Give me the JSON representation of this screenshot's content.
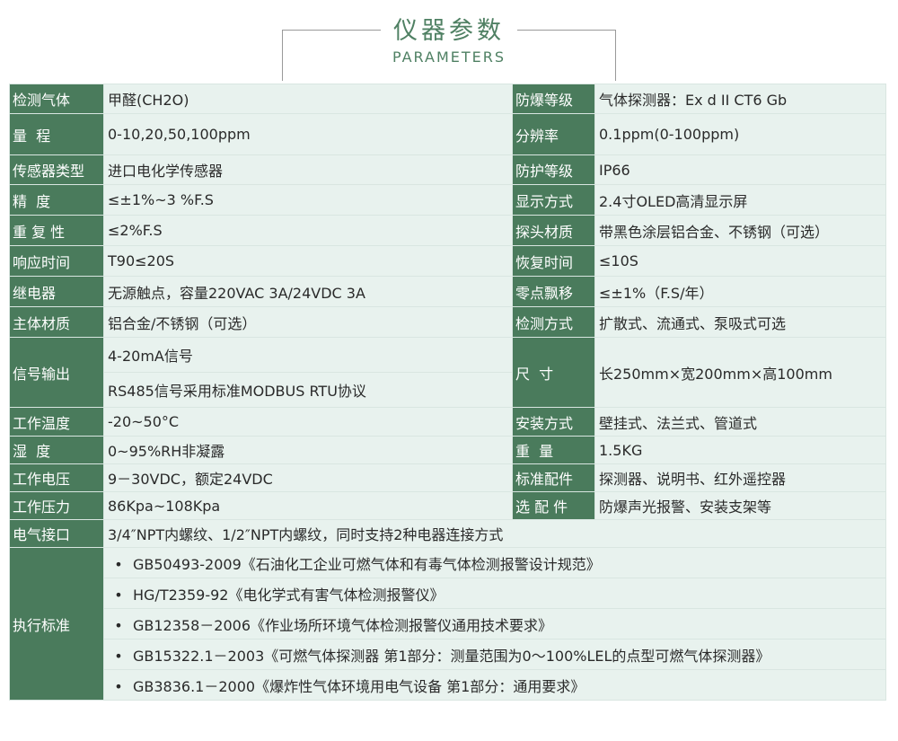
{
  "header": {
    "title": "仪器参数",
    "subtitle": "PARAMETERS"
  },
  "rows": {
    "r1": {
      "l1": "检测气体",
      "v1": "甲醛(CH2O)",
      "l2": "防爆等级",
      "v2": "气体探测器：Ex d II CT6 Gb"
    },
    "r2": {
      "l1": "量  程",
      "v1": "0-10,20,50,100ppm",
      "l2": "分辨率",
      "v2": "0.1ppm(0-100ppm)"
    },
    "r3": {
      "l1": "传感器类型",
      "v1": "进口电化学传感器",
      "l2": "防护等级",
      "v2": "IP66"
    },
    "r4": {
      "l1": "精  度",
      "v1": "≤±1%~3 %F.S",
      "l2": "显示方式",
      "v2": "2.4寸OLED高清显示屏"
    },
    "r5": {
      "l1": "重 复 性",
      "v1": "≤2%F.S",
      "l2": "探头材质",
      "v2": "带黑色涂层铝合金、不锈钢（可选）"
    },
    "r6": {
      "l1": "响应时间",
      "v1": "T90≤20S",
      "l2": "恢复时间",
      "v2": "≤10S"
    },
    "r7": {
      "l1": "继电器",
      "v1": "无源触点，容量220VAC 3A/24VDC 3A",
      "l2": "零点飘移",
      "v2": "≤±1%（F.S/年）"
    },
    "r8": {
      "l1": "主体材质",
      "v1": "铝合金/不锈钢（可选）",
      "l2": "检测方式",
      "v2": "扩散式、流通式、泵吸式可选"
    },
    "r9": {
      "l1": "信号输出",
      "v1a": "4-20mA信号",
      "v1b": "RS485信号采用标准MODBUS RTU协议",
      "l2": "尺  寸",
      "v2": "长250mm×宽200mm×高100mm"
    },
    "r10": {
      "l1": "工作温度",
      "v1": "-20~50°C",
      "l2": "安装方式",
      "v2": "壁挂式、法兰式、管道式"
    },
    "r11": {
      "l1": "湿  度",
      "v1": "0~95%RH非凝露",
      "l2": "重  量",
      "v2": "1.5KG"
    },
    "r12": {
      "l1": "工作电压",
      "v1": "9－30VDC，额定24VDC",
      "l2": "标准配件",
      "v2": "探测器、说明书、红外遥控器"
    },
    "r13": {
      "l1": "工作压力",
      "v1": "86Kpa~108Kpa",
      "l2": "选 配 件",
      "v2": "防爆声光报警、安装支架等"
    },
    "r14": {
      "l1": "电气接口",
      "v1": "3/4″NPT内螺纹、1/2″NPT内螺纹，同时支持2种电器连接方式"
    }
  },
  "standards": {
    "label": "执行标准",
    "bullet": "•",
    "items": [
      "GB50493-2009《石油化工企业可燃气体和有毒气体检测报警设计规范》",
      "HG/T2359-92《电化学式有害气体检测报警仪》",
      "GB12358－2006《作业场所环境气体检测报警仪通用技术要求》",
      "GB15322.1－2003《可燃气体探测器 第1部分：测量范围为0～100%LEL的点型可燃气体探测器》",
      "GB3836.1－2000《爆炸性气体环境用电气设备 第1部分：通用要求》"
    ]
  },
  "colors": {
    "label_bg": "#4a7b5c",
    "value_bg": "#e8f2ee",
    "title": "#4f8063"
  }
}
